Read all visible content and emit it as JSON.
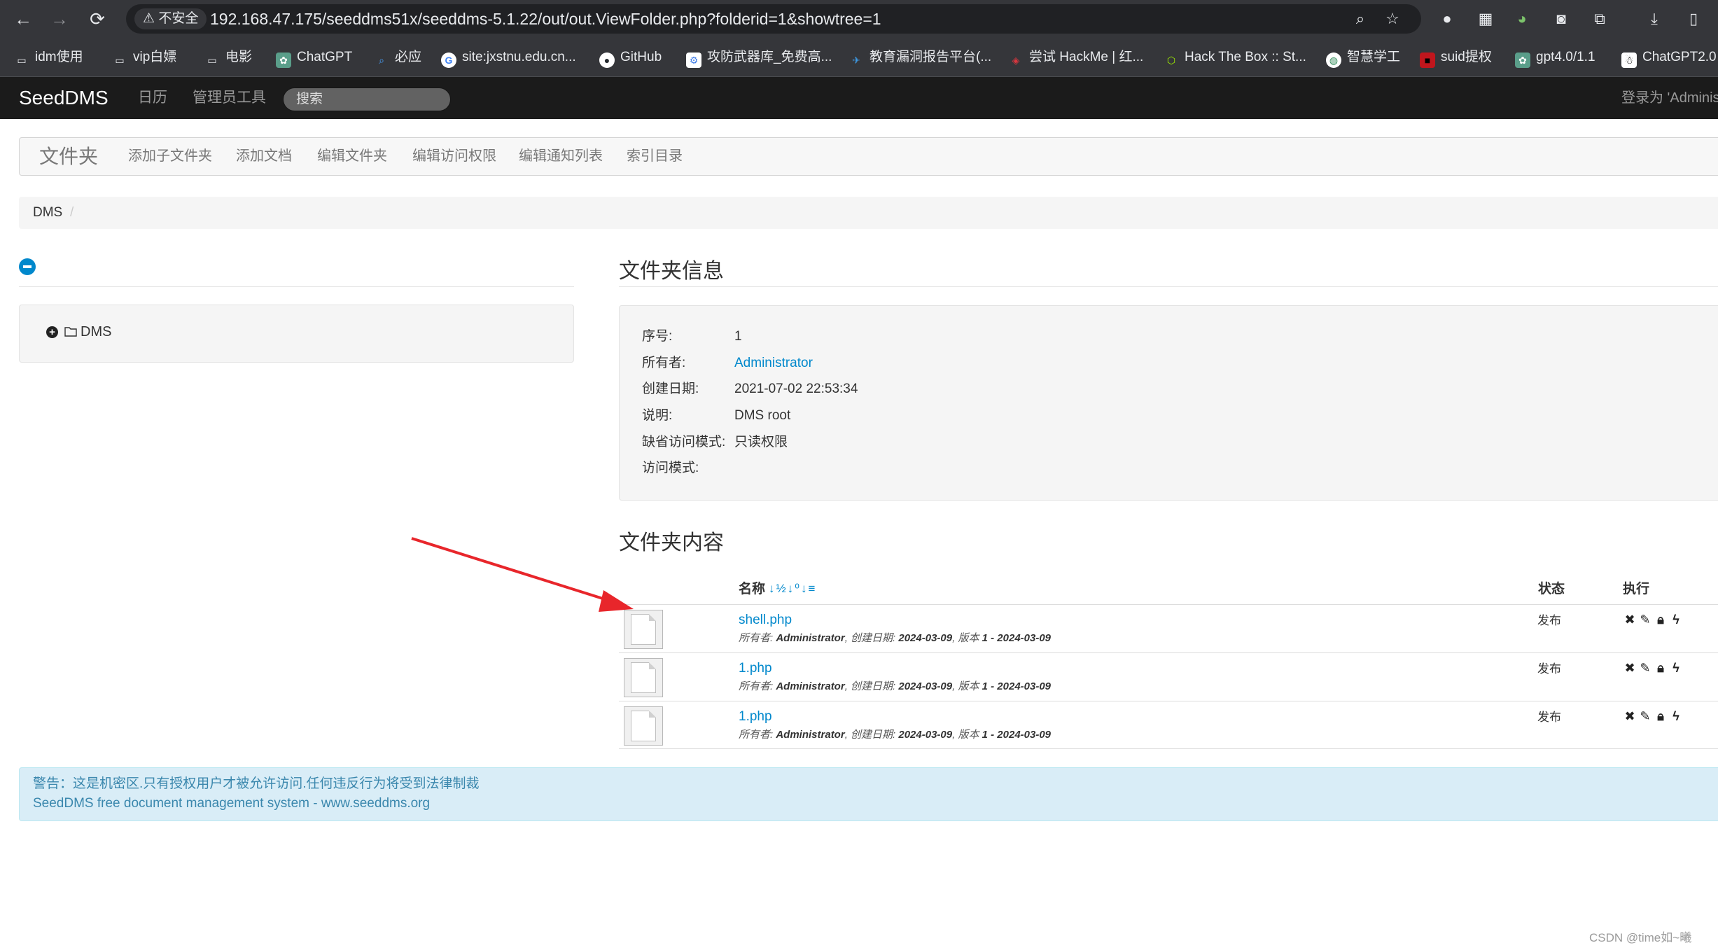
{
  "browser": {
    "security_label": "不安全",
    "url": "192.168.47.175/seeddms51x/seeddms-5.1.22/out/out.ViewFolder.php?folderid=1&showtree=1",
    "bookmarks": [
      {
        "label": "idm使用"
      },
      {
        "label": "vip白嫖"
      },
      {
        "label": "电影"
      },
      {
        "label": "ChatGPT"
      },
      {
        "label": "必应"
      },
      {
        "label": "site:jxstnu.edu.cn..."
      },
      {
        "label": "GitHub"
      },
      {
        "label": "攻防武器库_免费高..."
      },
      {
        "label": "教育漏洞报告平台(..."
      },
      {
        "label": "尝试 HackMe | 红..."
      },
      {
        "label": "Hack The Box :: St..."
      },
      {
        "label": "智慧学工"
      },
      {
        "label": "suid提权"
      },
      {
        "label": "gpt4.0/1.1"
      },
      {
        "label": "ChatGPT2.0"
      }
    ]
  },
  "navbar": {
    "brand": "SeedDMS",
    "calendar": "日历",
    "admin_tools": "管理员工具",
    "search_placeholder": "搜索",
    "login_status": "登录为 'Administ"
  },
  "subnav": {
    "title": "文件夹",
    "items": [
      "添加子文件夹",
      "添加文档",
      "编辑文件夹",
      "编辑访问权限",
      "编辑通知列表",
      "索引目录"
    ]
  },
  "breadcrumb": {
    "root": "DMS",
    "separator": "/"
  },
  "tree": {
    "root_label": "DMS"
  },
  "folder_info": {
    "heading": "文件夹信息",
    "rows": [
      {
        "label": "序号:",
        "value": "1"
      },
      {
        "label": "所有者:",
        "value": "Administrator"
      },
      {
        "label": "创建日期:",
        "value": "2021-07-02 22:53:34"
      },
      {
        "label": "说明:",
        "value": "DMS root"
      },
      {
        "label": "缺省访问模式:",
        "value": "只读权限"
      },
      {
        "label": "访问模式:",
        "value": ""
      }
    ]
  },
  "folder_content": {
    "heading": "文件夹内容",
    "col_name": "名称",
    "col_status": "状态",
    "col_actions": "执行",
    "sort_icons": "↓½↓⁰↓≡",
    "documents": [
      {
        "name": "shell.php",
        "owner_label": "所有者:",
        "owner": "Administrator",
        "created_label": ", 创建日期:",
        "created": "2024-03-09",
        "version_label": ", 版本",
        "version": "1 - 2024-03-09",
        "status": "发布"
      },
      {
        "name": "1.php",
        "owner_label": "所有者:",
        "owner": "Administrator",
        "created_label": ", 创建日期:",
        "created": "2024-03-09",
        "version_label": ", 版本",
        "version": "1 - 2024-03-09",
        "status": "发布"
      },
      {
        "name": "1.php",
        "owner_label": "所有者:",
        "owner": "Administrator",
        "created_label": ", 创建日期:",
        "created": "2024-03-09",
        "version_label": ", 版本",
        "version": "1 - 2024-03-09",
        "status": "发布"
      }
    ]
  },
  "footer": {
    "warning": "警告：这是机密区.只有授权用户才被允许访问.任何违反行为将受到法律制裁",
    "credit": "SeedDMS free document management system - www.seeddms.org"
  },
  "watermark": "CSDN @time如~曦",
  "colors": {
    "accent": "#0088cc",
    "navbar": "#1b1b1b",
    "annotation_arrow": "#e8262b"
  }
}
